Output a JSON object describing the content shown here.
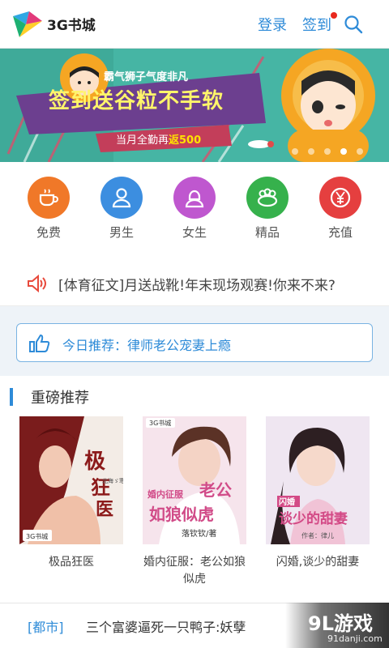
{
  "header": {
    "brand": "3G书城",
    "login_label": "登录",
    "signin_label": "签到",
    "brand_colors": [
      "#2fa7e4",
      "#e23a7b",
      "#1db072",
      "#ffcf2a"
    ]
  },
  "banner": {
    "subtitle": "霸气狮子气度非凡",
    "title": "签到送谷粒不手软",
    "footer_prefix": "当月全勤再",
    "footer_highlight": "返500",
    "slides_total": 5,
    "active_slide": 4
  },
  "categories": [
    {
      "label": "免费",
      "icon": "coffee-cup-icon",
      "color": "#f07828"
    },
    {
      "label": "男生",
      "icon": "male-user-icon",
      "color": "#3c8ee0"
    },
    {
      "label": "女生",
      "icon": "female-user-icon",
      "color": "#bf57cf"
    },
    {
      "label": "精品",
      "icon": "crown-icon",
      "color": "#36b14c"
    },
    {
      "label": "充值",
      "icon": "yuan-coin-icon",
      "color": "#e53f3f"
    }
  ],
  "notice": {
    "icon": "speaker-icon",
    "text": "[体育征文]月送战靴!年末现场观赛!你来不来?"
  },
  "recommend": {
    "icon": "thumbs-up-icon",
    "text": "今日推荐：律师老公宠妻上瘾"
  },
  "featured": {
    "title": "重磅推荐",
    "books": [
      {
        "title": "极品狂医",
        "cover_text": "极品狂医",
        "author": "北海ゞ寒",
        "badge": "3G书城"
      },
      {
        "title": "婚内征服：老公如狼似虎",
        "cover_text": "婚内征服 老公如狼似虎",
        "author": "落钦钦/著",
        "badge": "3G书城"
      },
      {
        "title": "闪婚,谈少的甜妻",
        "cover_text": "闪婚 谈少的甜妻",
        "author": "作者：律儿",
        "badge": ""
      }
    ]
  },
  "list": {
    "tag": "[都市]",
    "text": "三个富婆逼死一只鸭子:妖孽"
  },
  "watermark": {
    "logo": "9L游戏",
    "url": "91danji.com"
  }
}
